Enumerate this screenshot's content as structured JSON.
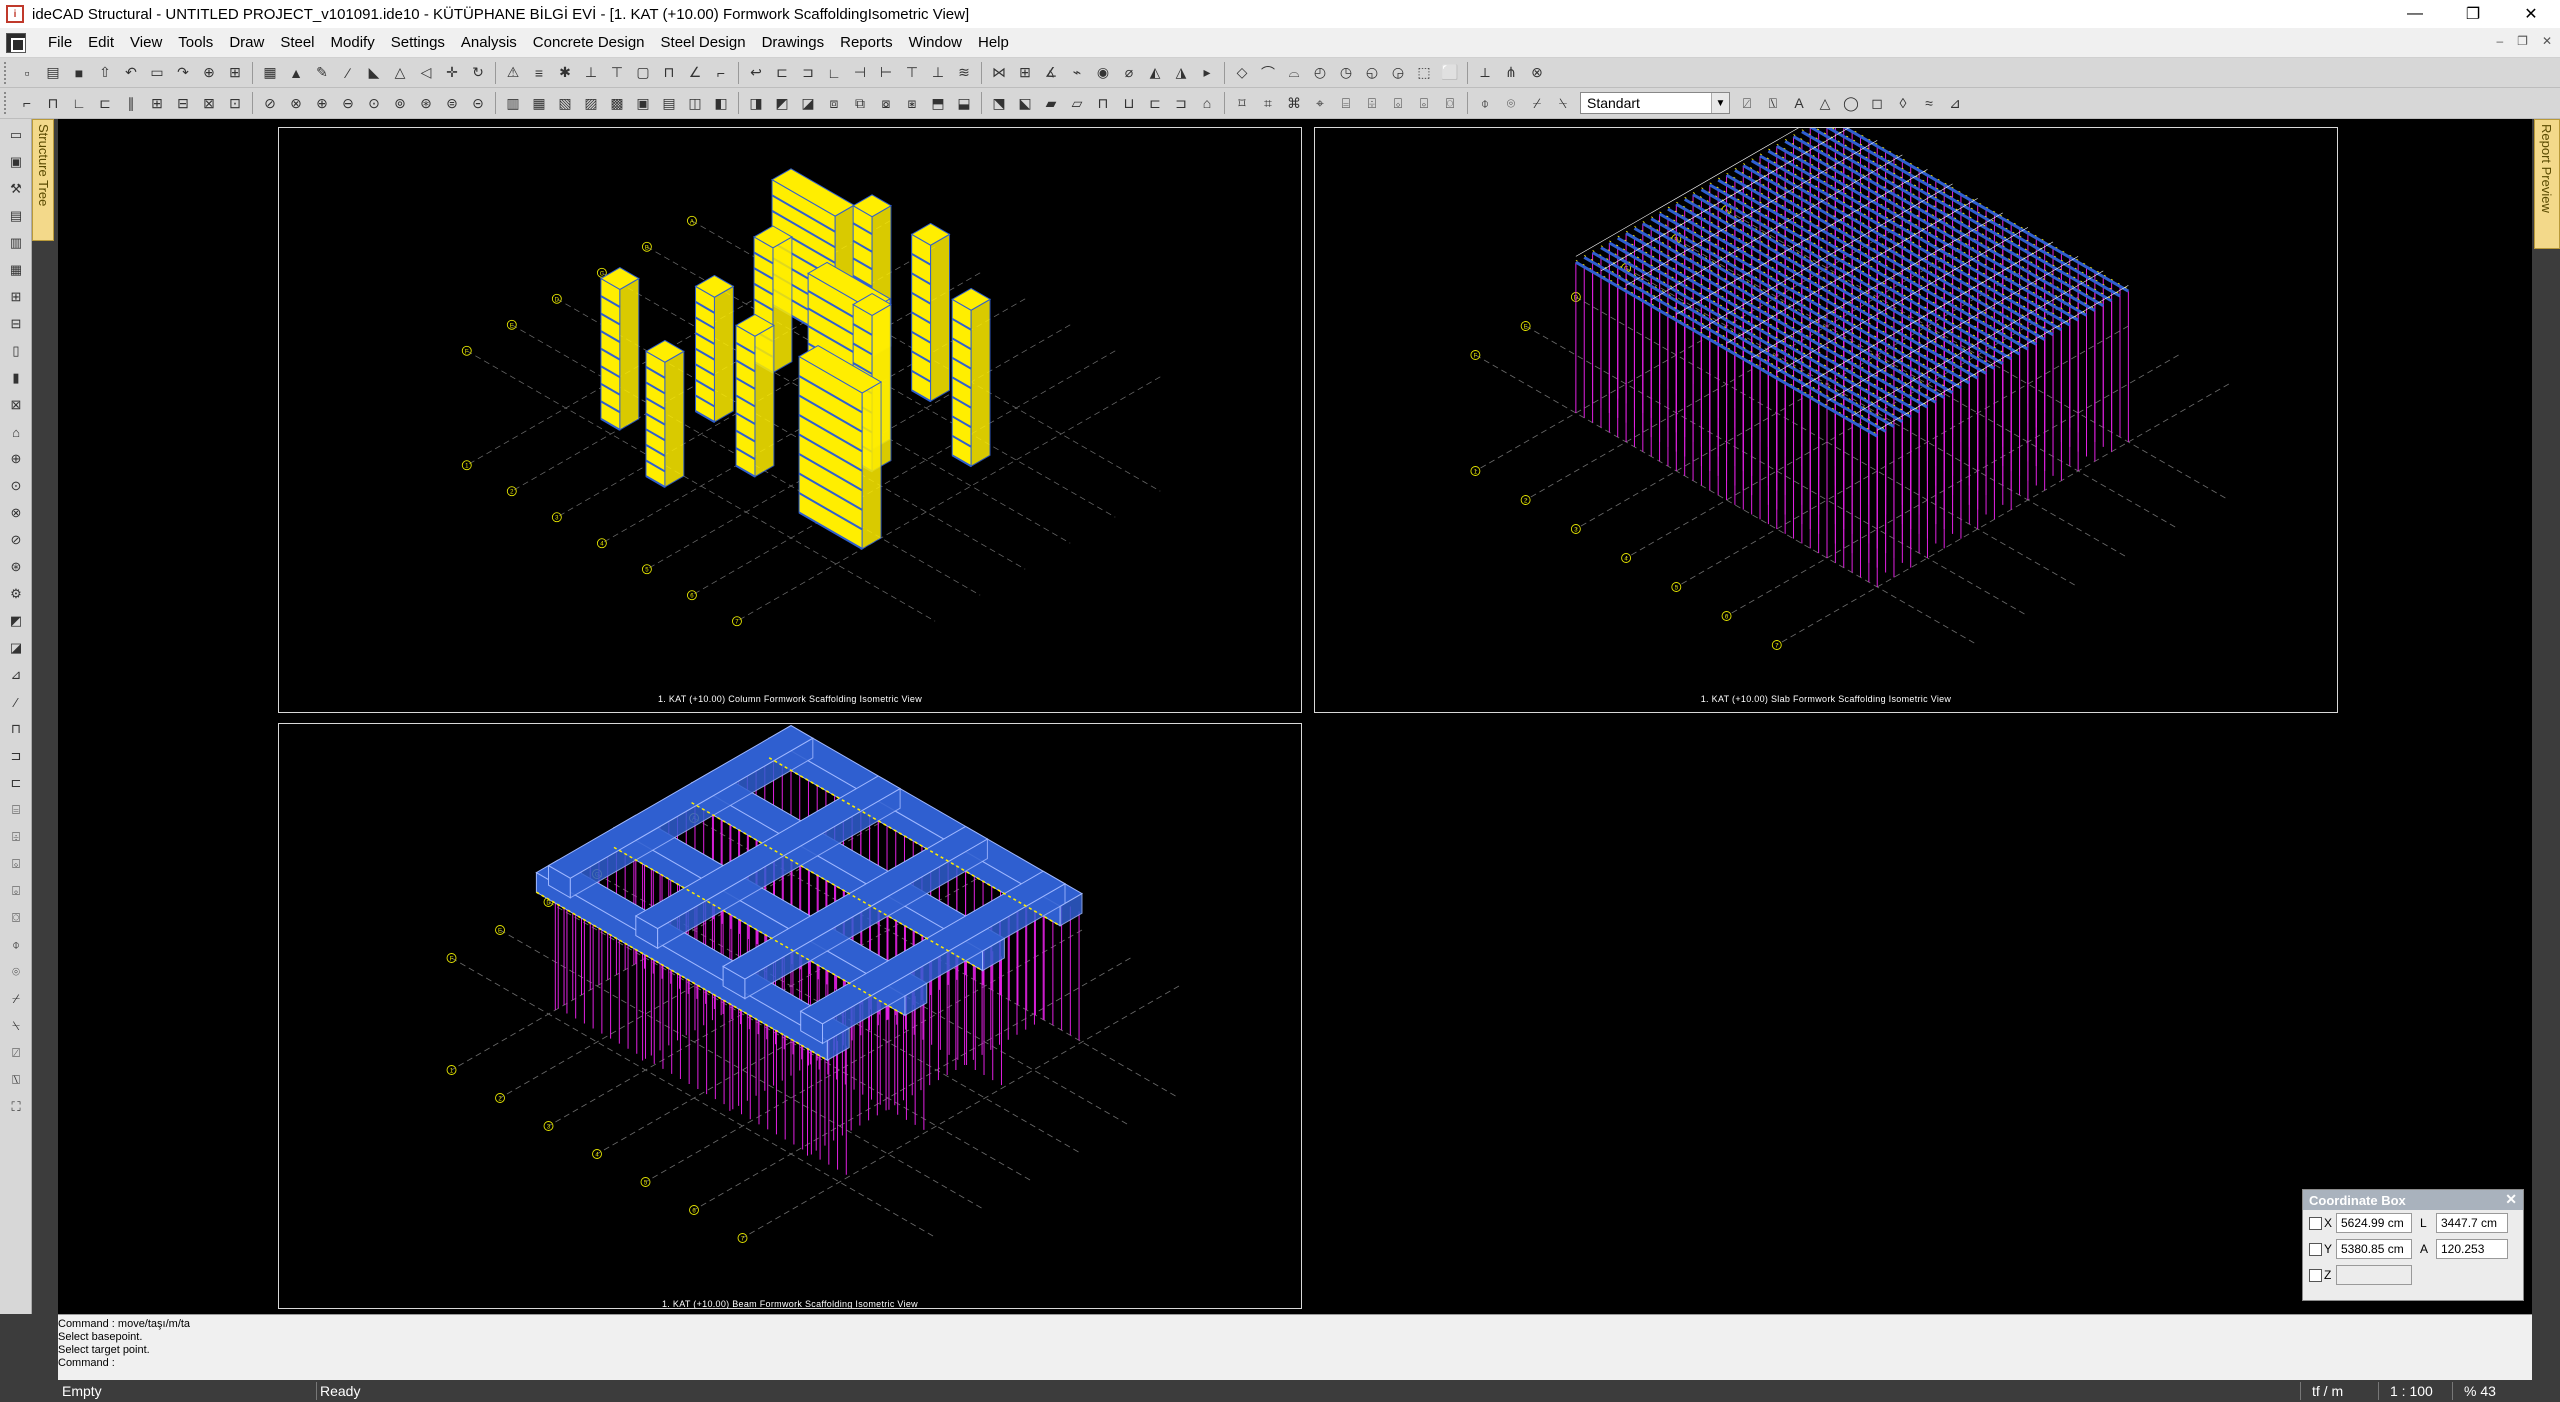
{
  "window": {
    "title": "ideCAD Structural - UNTITLED PROJECT_v101091.ide10 - KÜTÜPHANE BİLGİ EVİ - [1. KAT (+10.00) Formwork ScaffoldingIsometric View]",
    "minimize": "—",
    "restore": "❐",
    "close": "✕"
  },
  "menubar": {
    "items": [
      "File",
      "Edit",
      "View",
      "Tools",
      "Draw",
      "Steel",
      "Modify",
      "Settings",
      "Analysis",
      "Concrete Design",
      "Steel Design",
      "Drawings",
      "Reports",
      "Window",
      "Help"
    ],
    "mdi_min": "–",
    "mdi_restore": "❐",
    "mdi_close": "✕"
  },
  "toolbar": {
    "style_label": "Standart"
  },
  "side_tabs": {
    "structure_tree": "Structure Tree",
    "report_preview": "Report Preview"
  },
  "viewports": {
    "column": {
      "caption": "1. KAT (+10.00) Column Formwork Scaffolding Isometric View"
    },
    "slab": {
      "caption": "1. KAT (+10.00) Slab Formwork Scaffolding Isometric View"
    },
    "beam": {
      "caption": "1. KAT (+10.00) Beam Formwork Scaffolding Isometric View"
    }
  },
  "axis_labels": [
    "1",
    "2",
    "3",
    "4",
    "5",
    "6",
    "7",
    "A",
    "B",
    "C",
    "D",
    "E",
    "F",
    "A'",
    "B'",
    "F'"
  ],
  "coordinate_box": {
    "title": "Coordinate Box",
    "close": "✕",
    "x_label": "X",
    "x_value": "5624.99 cm",
    "y_label": "Y",
    "y_value": "5380.85 cm",
    "z_label": "Z",
    "z_value": "",
    "l_label": "L",
    "l_value": "3447.7 cm",
    "a_label": "A",
    "a_value": "120.253"
  },
  "command": {
    "lines": [
      "Command : move/taşı/m/ta",
      "Select basepoint.",
      "Select target point.",
      "Command :"
    ]
  },
  "status": {
    "left": "Empty",
    "state": "Ready",
    "units": "tf / m",
    "scale": "1 : 100",
    "zoom": "% 43"
  },
  "colors": {
    "canvas": "#000000",
    "formwork_yellow": "#ffee00",
    "scaffold_blue": "#2f5fd0",
    "prop_magenta": "#e020e0",
    "axis_label": "#e5e500"
  }
}
